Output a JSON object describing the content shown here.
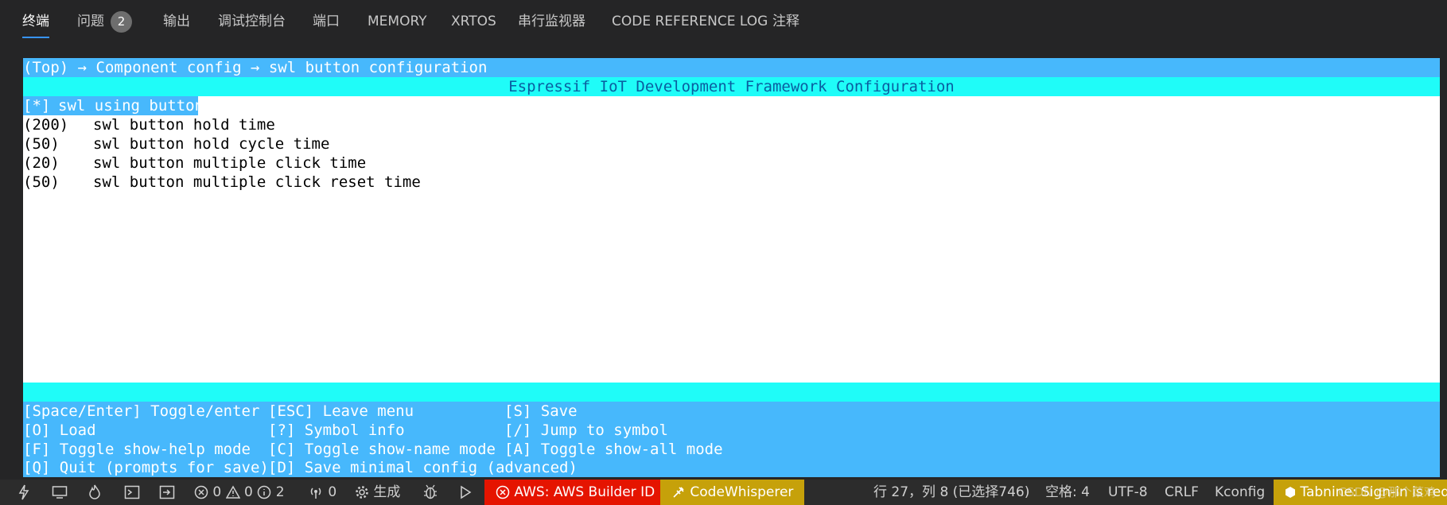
{
  "tabs": [
    {
      "label": "终端",
      "active": true
    },
    {
      "label": "问题",
      "badge": "2"
    },
    {
      "label": "输出"
    },
    {
      "label": "调试控制台"
    },
    {
      "label": "端口"
    },
    {
      "label": "MEMORY"
    },
    {
      "label": "XRTOS"
    },
    {
      "label": "串行监视器"
    },
    {
      "label": "CODE REFERENCE LOG"
    },
    {
      "label": "注释"
    }
  ],
  "terminal": {
    "breadcrumb": "(Top) → Component config → swl button configuration",
    "title": "Espressif IoT Development Framework Configuration",
    "items": [
      {
        "value": "[*]",
        "label": "swl using button",
        "selected": true
      },
      {
        "value": "(200)",
        "label": "swl button hold time"
      },
      {
        "value": "(50)",
        "label": "swl button hold cycle time"
      },
      {
        "value": "(20)",
        "label": "swl button multiple click time"
      },
      {
        "value": "(50)",
        "label": "swl button multiple click reset time"
      }
    ],
    "help": [
      [
        "[Space/Enter] Toggle/enter",
        "[ESC] Leave menu",
        "[S] Save"
      ],
      [
        "[O] Load",
        "[?] Symbol info",
        "[/] Jump to symbol"
      ],
      [
        "[F] Toggle show-help mode",
        "[C] Toggle show-name mode",
        "[A] Toggle show-all mode"
      ],
      [
        "[Q] Quit (prompts for save)",
        "[D] Save minimal config (advanced)",
        ""
      ]
    ]
  },
  "statusbar": {
    "errors": "0",
    "warnings": "0",
    "infos": "2",
    "ports": "0",
    "build": "生成",
    "aws": "AWS: AWS Builder ID",
    "codewhisperer": "CodeWhisperer",
    "position": "行 27，列 8 (已选择746)",
    "spaces": "空格: 4",
    "encoding": "UTF-8",
    "eol": "CRLF",
    "language": "Kconfig",
    "tabnine": "Tabnine: Sign-in is requ",
    "watermark": "CSDN @那个菜鸡"
  },
  "colors": {
    "terminal_blue": "#47b8fc",
    "terminal_cyan": "#1ffcf8",
    "aws_red": "#e51400",
    "codewhisperer_yellow": "#c6a10a"
  }
}
